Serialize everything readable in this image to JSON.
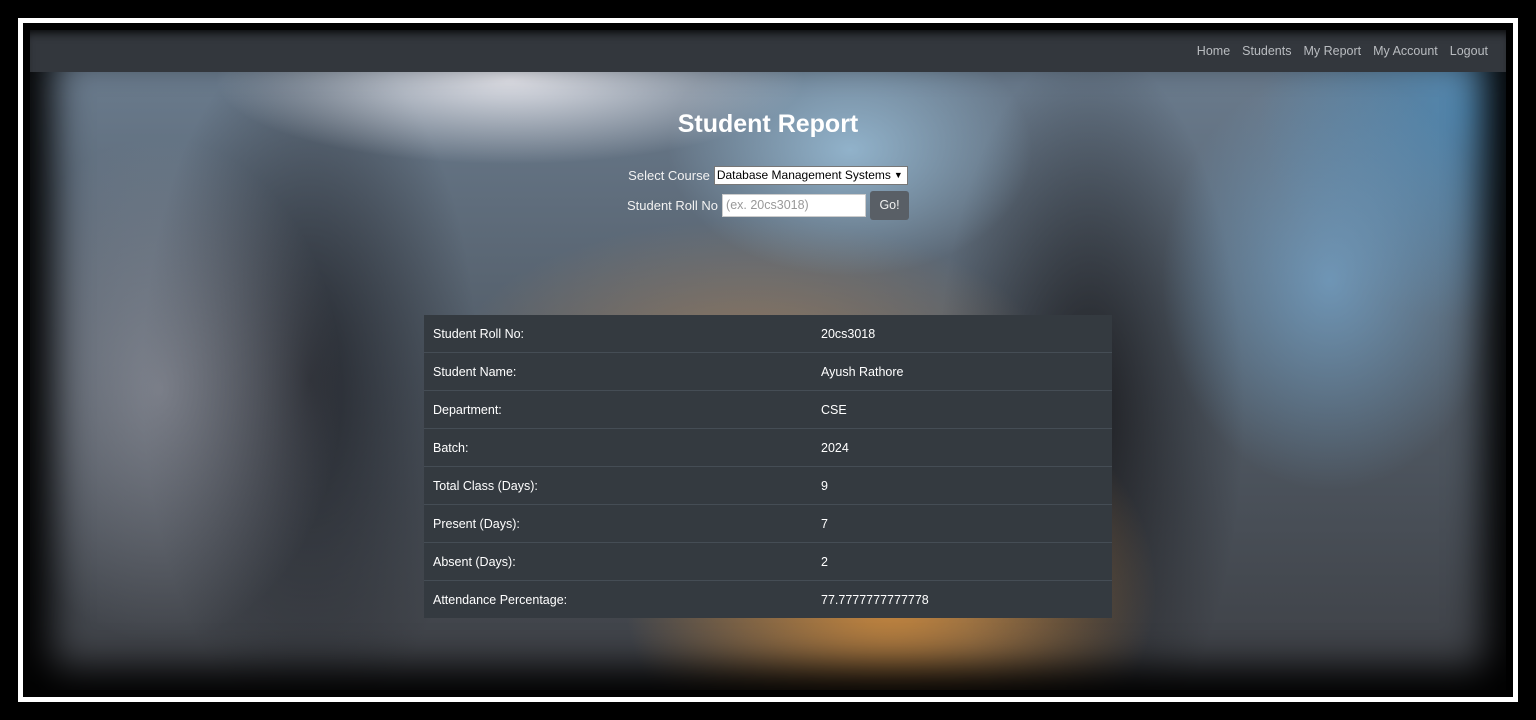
{
  "nav": {
    "links": [
      "Home",
      "Students",
      "My Report",
      "My Account",
      "Logout"
    ]
  },
  "page": {
    "title": "Student Report"
  },
  "form": {
    "course_label": "Select Course",
    "course_selected": "Database Management Systems",
    "roll_label": "Student Roll No",
    "roll_placeholder": "(ex. 20cs3018)",
    "roll_value": "",
    "go_label": "Go!"
  },
  "report": {
    "rows": [
      {
        "label": "Student Roll No:",
        "value": "20cs3018"
      },
      {
        "label": "Student Name:",
        "value": "Ayush Rathore"
      },
      {
        "label": "Department:",
        "value": "CSE"
      },
      {
        "label": "Batch:",
        "value": "2024"
      },
      {
        "label": "Total Class (Days):",
        "value": "9"
      },
      {
        "label": "Present (Days):",
        "value": "7"
      },
      {
        "label": "Absent (Days):",
        "value": "2"
      },
      {
        "label": "Attendance Percentage:",
        "value": "77.7777777777778"
      }
    ]
  }
}
